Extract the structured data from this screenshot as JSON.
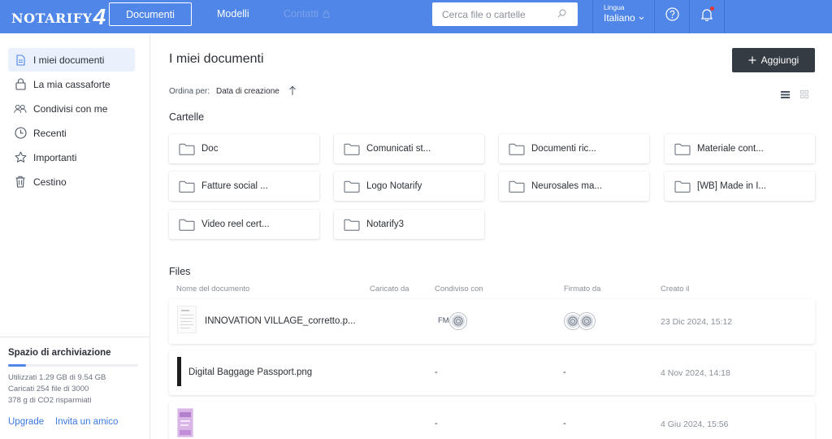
{
  "app": {
    "logo_text": "NOTARIFY",
    "logo_number": "4"
  },
  "topnav": {
    "documents": "Documenti",
    "models": "Modelli",
    "contacts": "Contatti",
    "search_placeholder": "Cerca file o cartelle",
    "language_label": "Lingua",
    "language_value": "Italiano"
  },
  "sidebar": {
    "items": [
      {
        "label": "I miei documenti",
        "icon": "document-icon",
        "active": true
      },
      {
        "label": "La mia cassaforte",
        "icon": "lock-icon",
        "active": false
      },
      {
        "label": "Condivisi con me",
        "icon": "users-icon",
        "active": false
      },
      {
        "label": "Recenti",
        "icon": "clock-icon",
        "active": false
      },
      {
        "label": "Importanti",
        "icon": "star-icon",
        "active": false
      },
      {
        "label": "Cestino",
        "icon": "trash-icon",
        "active": false
      }
    ],
    "storage": {
      "title": "Spazio di archiviazione",
      "usage_fraction": 0.135,
      "used": "Utilizzati 1.29 GB di 9.54 GB",
      "uploaded": "Caricati 254 file di 3000",
      "co2": "378 g di CO2 risparmiati"
    },
    "links": {
      "upgrade": "Upgrade",
      "invite": "Invita un amico"
    }
  },
  "main": {
    "title": "I miei documenti",
    "add_button": "Aggiungi",
    "sort_label": "Ordina per:",
    "sort_value": "Data di creazione",
    "folders_heading": "Cartelle",
    "folders": [
      "Doc",
      "Comunicati st...",
      "Documenti ric...",
      "Materiale cont...",
      "Fatture social ...",
      "Logo Notarify",
      "Neurosales ma...",
      "[WB] Made in I...",
      "Video reel cert...",
      "Notarify3"
    ],
    "files_heading": "Files",
    "columns": {
      "name": "Nome del documento",
      "uploaded_by": "Caricato da",
      "shared_with": "Condiviso con",
      "signed_by": "Firmato da",
      "created": "Creato il"
    },
    "files": [
      {
        "name": "INNOVATION VILLAGE_corretto.p...",
        "shared_initials": "FM",
        "shared": "",
        "signed": "",
        "created": "23 Dic 2024, 15:12"
      },
      {
        "name": "Digital Baggage Passport.png",
        "shared_initials": "",
        "shared": "-",
        "signed": "-",
        "created": "4 Nov 2024, 14:18"
      },
      {
        "name": "",
        "shared_initials": "",
        "shared": "-",
        "signed": "-",
        "created": "4 Giu 2024, 15:56"
      }
    ]
  }
}
